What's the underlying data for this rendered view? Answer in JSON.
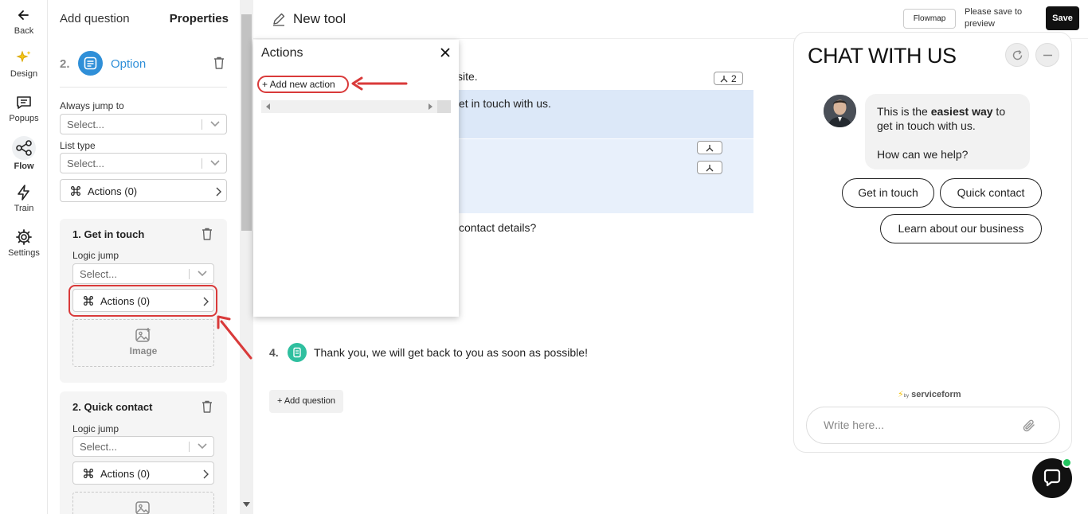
{
  "rail": {
    "back": "Back",
    "items": [
      {
        "label": "Design",
        "icon": "sparkles-icon"
      },
      {
        "label": "Popups",
        "icon": "chat-box-icon"
      },
      {
        "label": "Flow",
        "icon": "share-nodes-icon"
      },
      {
        "label": "Train",
        "icon": "lightning-icon"
      },
      {
        "label": "Settings",
        "icon": "gear-icon"
      }
    ],
    "active": "Flow"
  },
  "properties": {
    "tab_add": "Add question",
    "tab_props": "Properties",
    "question_num": "2.",
    "question_type": "Option",
    "always_jump_label": "Always jump to",
    "always_jump_placeholder": "Select...",
    "list_type_label": "List type",
    "list_type_placeholder": "Select...",
    "actions_label": "Actions (0)",
    "options": [
      {
        "title": "1. Get in touch",
        "logic_label": "Logic jump",
        "placeholder": "Select...",
        "actions": "Actions (0)",
        "image_label": "Image"
      },
      {
        "title": "2. Quick contact",
        "logic_label": "Logic jump",
        "placeholder": "Select...",
        "actions": "Actions (0)"
      }
    ]
  },
  "topbar": {
    "title": "New tool",
    "flowmap": "Flowmap",
    "save_hint": "Please save to preview",
    "save": "Save"
  },
  "canvas": {
    "q1_tail": "site.",
    "q1_badge": "2",
    "q1_option_tail": "et in touch with us.",
    "q3_tail": "contact details?",
    "q4_num": "4.",
    "q4_text": "Thank you, we will get back to you as soon as possible!",
    "add_question": "+ Add question"
  },
  "actions_popup": {
    "title": "Actions",
    "add_action": "+ Add new action"
  },
  "chat": {
    "title": "CHAT WITH US",
    "msg_pre": "This is the ",
    "msg_bold": "easiest way",
    "msg_post": " to get in touch with us.",
    "msg_2": "How can we help?",
    "quick_replies": [
      "Get in touch",
      "Quick contact",
      "Learn about our business"
    ],
    "powered_by": "by",
    "brand": "serviceform",
    "input_placeholder": "Write here..."
  },
  "colors": {
    "accent": "#2f8fd8",
    "highlight": "#d93a3a",
    "band": "#dce8f8",
    "online": "#22c55e"
  }
}
